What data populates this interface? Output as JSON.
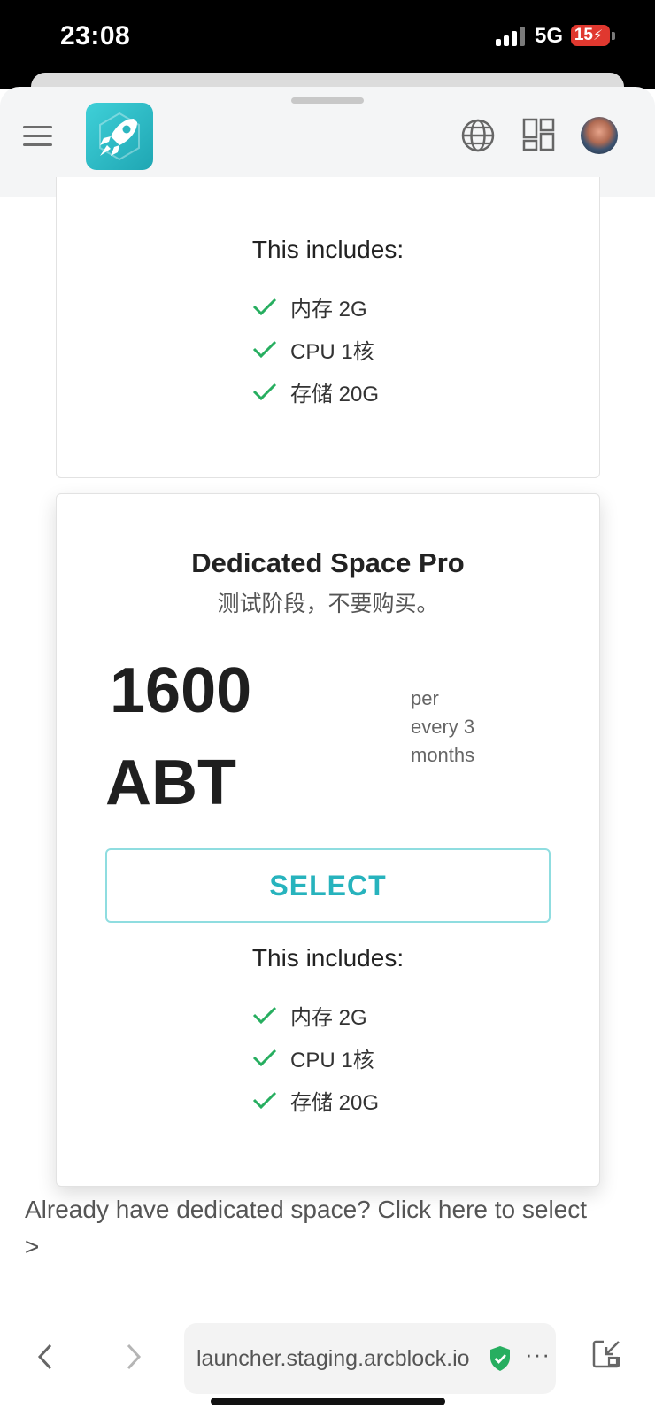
{
  "status_bar": {
    "time": "23:08",
    "network": "5G",
    "battery": "15"
  },
  "header": {
    "icons": [
      "menu-icon",
      "rocket-logo",
      "globe-icon",
      "grid-icon",
      "avatar"
    ]
  },
  "plans": [
    {
      "includes_title": "This includes:",
      "features": [
        "内存 2G",
        "CPU 1核",
        "存储 20G"
      ]
    },
    {
      "title": "Dedicated Space Pro",
      "subtitle": "测试阶段，不要购买。",
      "price_amount": "1600",
      "price_currency": "ABT",
      "period_line1": "per",
      "period_line2": "every 3",
      "period_line3": "months",
      "select_label": "SELECT",
      "includes_title": "This includes:",
      "features": [
        "内存 2G",
        "CPU 1核",
        "存储 20G"
      ]
    }
  ],
  "already_link": {
    "text": "Already have dedicated space? Click here to select",
    "arrow": ">"
  },
  "browser": {
    "url": "launcher.staging.arcblock.io",
    "more": "···"
  },
  "colors": {
    "accent": "#27b3bd",
    "check": "#27ae60",
    "battery_low": "#e0382f"
  }
}
